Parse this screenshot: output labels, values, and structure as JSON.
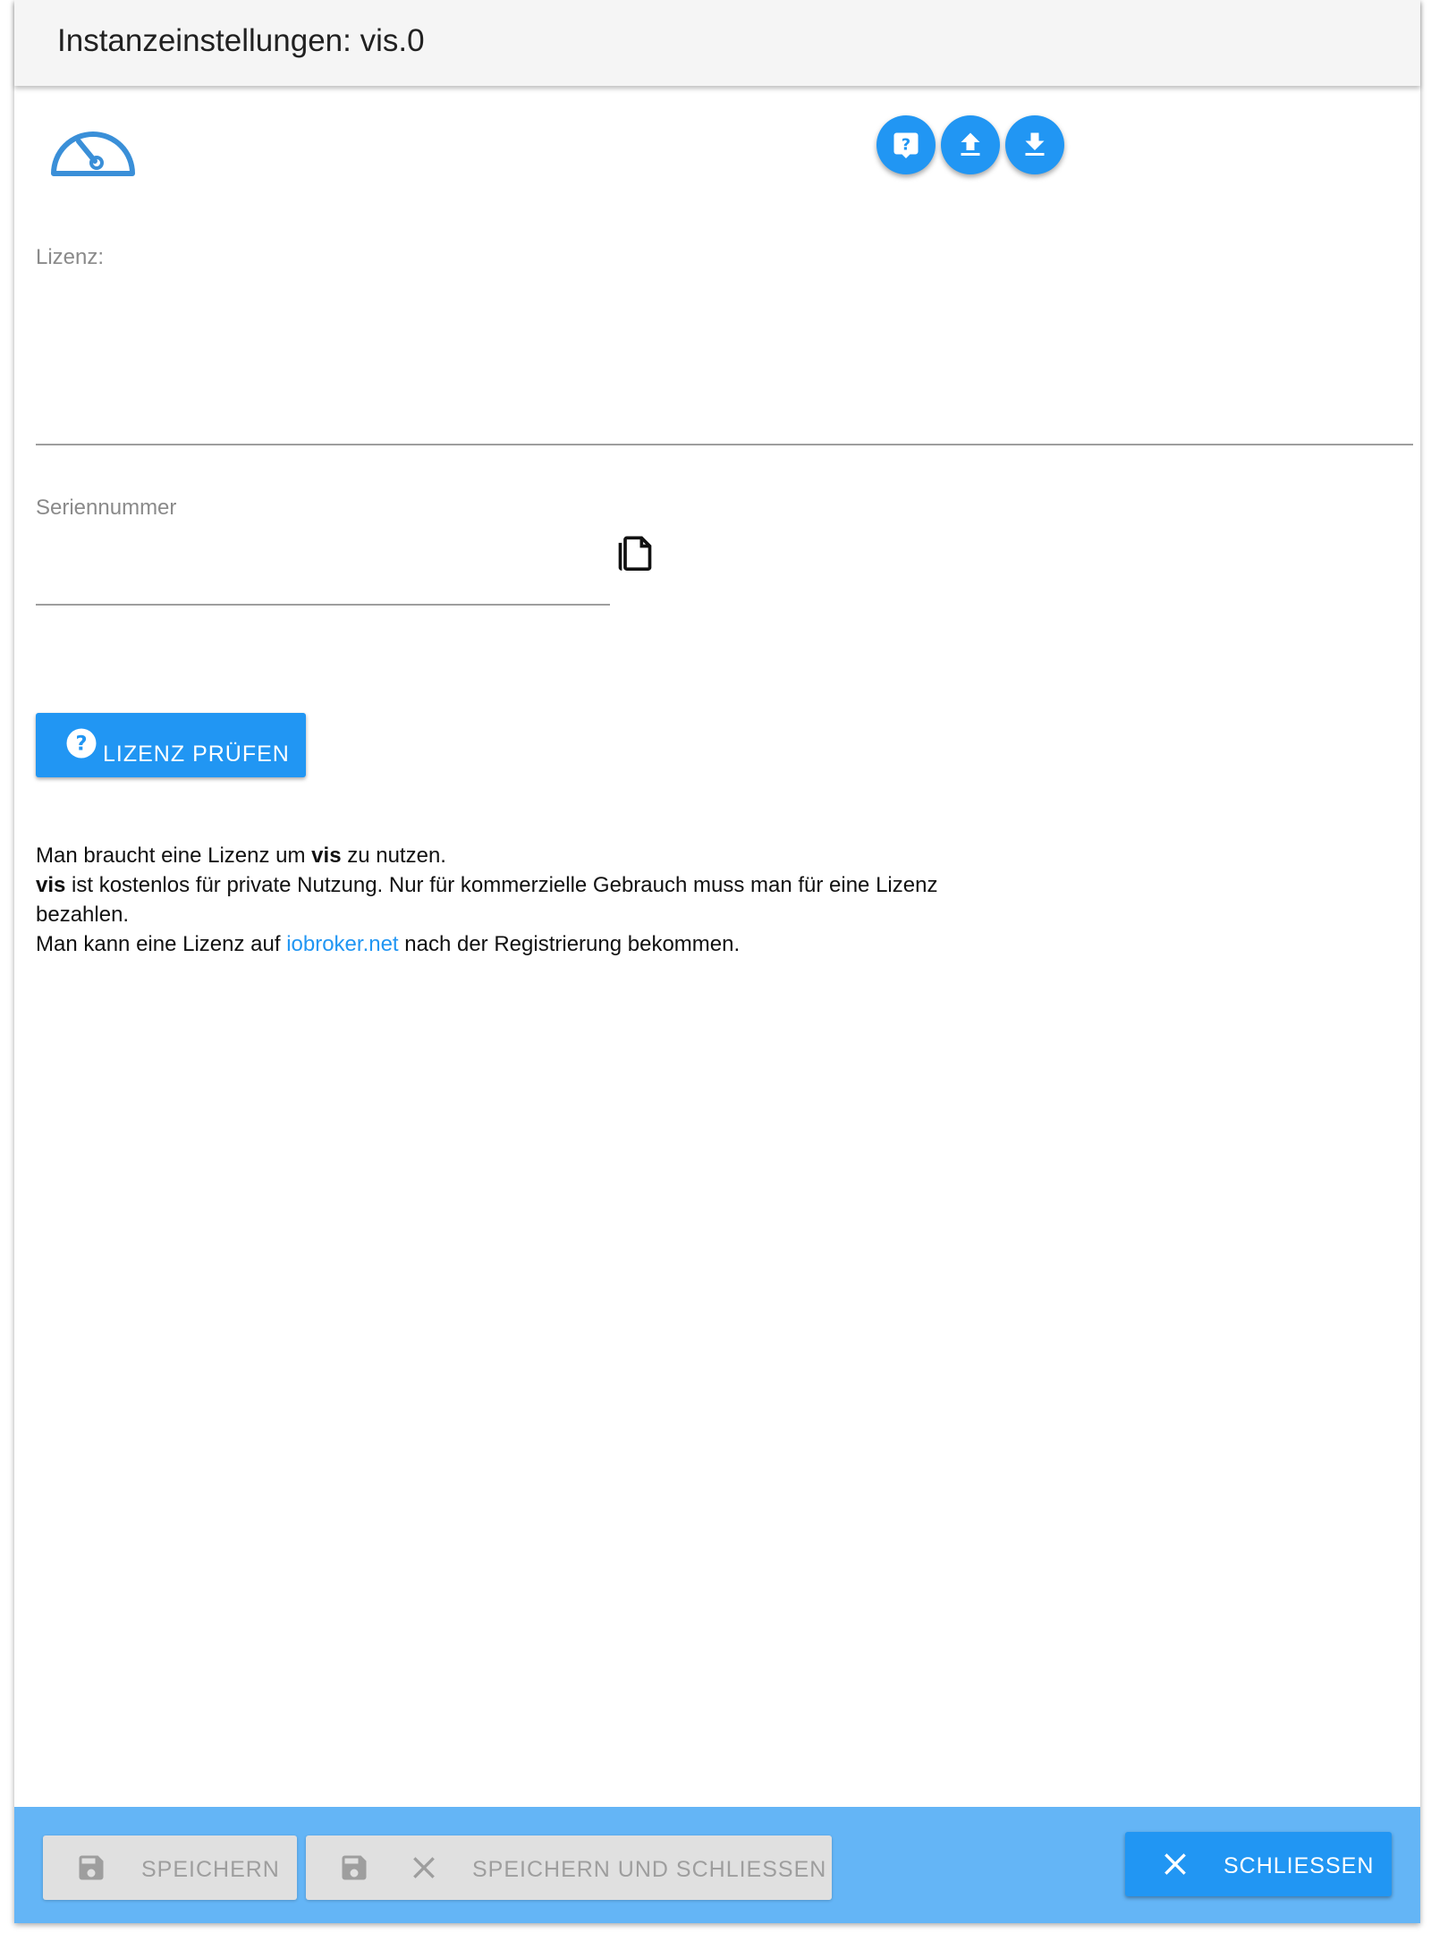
{
  "dialog": {
    "title": "Instanzeinstellungen: vis.0"
  },
  "toolbar": {
    "logo_icon": "speedometer-gauge-icon",
    "help_icon": "help-icon",
    "upload_icon": "upload-icon",
    "download_icon": "download-icon"
  },
  "license": {
    "label": "Lizenz:",
    "value": ""
  },
  "serial": {
    "label": "Seriennummer",
    "value": "",
    "copy_icon": "copy-icon"
  },
  "check_button": {
    "label": "LIZENZ PRÜFEN",
    "icon": "help-circle-icon"
  },
  "info": {
    "line1_a": "Man braucht eine Lizenz um ",
    "line1_b": "vis",
    "line1_c": " zu nutzen.",
    "line2_a": "vis",
    "line2_b": " ist kostenlos für private Nutzung. Nur für kommerzielle Gebrauch muss man für eine Lizenz bezahlen.",
    "line3_a": "Man kann eine Lizenz auf ",
    "line3_link": "iobroker.net",
    "line3_b": " nach der Registrierung bekommen."
  },
  "footer": {
    "save_label": "SPEICHERN",
    "save_close_label": "SPEICHERN UND SCHLIESSEN",
    "close_label": "SCHLIESSEN"
  },
  "colors": {
    "accent": "#2196f3",
    "footer_bg": "#64b5f6",
    "disabled_bg": "#e0e0e0"
  }
}
